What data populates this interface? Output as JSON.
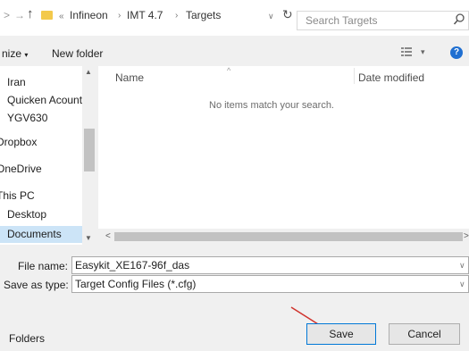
{
  "address": {
    "crumbs": [
      "Infineon",
      "IMT 4.7",
      "Targets"
    ],
    "search_placeholder": "Search Targets"
  },
  "toolbar": {
    "organize_label": "nize",
    "new_folder_label": "New folder"
  },
  "nav_pane": {
    "items": [
      {
        "label": "Iran"
      },
      {
        "label": "Quicken Acounts"
      },
      {
        "label": "YGV630"
      },
      {
        "label": "Dropbox"
      },
      {
        "label": "OneDrive"
      },
      {
        "label": "This PC"
      },
      {
        "label": "Desktop"
      },
      {
        "label": "Documents",
        "selected": true
      }
    ]
  },
  "file_list": {
    "columns": [
      "Name",
      "Date modified"
    ],
    "empty_message": "No items match your search."
  },
  "form": {
    "file_name_label": "File name:",
    "file_name_value": "Easykit_XE167-96f_das",
    "save_type_label": "Save as type:",
    "save_type_value": "Target Config Files (*.cfg)"
  },
  "bottom": {
    "folders_label": "Folders",
    "save_label": "Save",
    "cancel_label": "Cancel"
  },
  "colors": {
    "accent": "#0078d7",
    "arrow": "#d0332d",
    "selection": "#cce4f7",
    "help_icon": "#1f6fd1",
    "folder_icon": "#f3c94b"
  },
  "icons": [
    "back-arrow-icon",
    "forward-arrow-icon",
    "up-arrow-icon",
    "folder-icon",
    "refresh-icon",
    "search-icon",
    "view-options-icon",
    "help-icon",
    "red-pointer-arrow"
  ]
}
